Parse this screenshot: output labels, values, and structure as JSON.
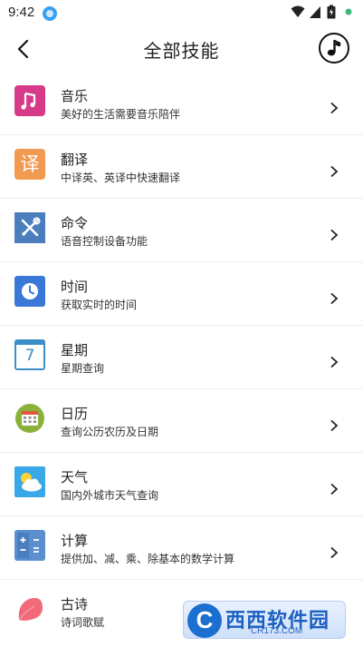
{
  "status_bar": {
    "time": "9:42"
  },
  "header": {
    "title": "全部技能"
  },
  "skills": [
    {
      "name": "音乐",
      "desc": "美好的生活需要音乐陪伴",
      "icon": "music-note-icon",
      "color": "#d83a8a"
    },
    {
      "name": "翻译",
      "desc": "中译英、英译中快速翻译",
      "icon": "translate-icon",
      "color": "#f39a52",
      "glyph": "译"
    },
    {
      "name": "命令",
      "desc": "语音控制设备功能",
      "icon": "tools-icon",
      "color": "#4a7ebd"
    },
    {
      "name": "时间",
      "desc": "获取实时的时间",
      "icon": "clock-icon",
      "color": "#3a78d8"
    },
    {
      "name": "星期",
      "desc": "星期查询",
      "icon": "calendar-icon",
      "color": "#3a8fc8",
      "glyph": "7"
    },
    {
      "name": "日历",
      "desc": "查询公历农历及日期",
      "icon": "calendar-grid-icon",
      "color": "#8cb13a"
    },
    {
      "name": "天气",
      "desc": "国内外城市天气查询",
      "icon": "weather-icon",
      "color": "#3aa8e8"
    },
    {
      "name": "计算",
      "desc": "提供加、减、乘、除基本的数学计算",
      "icon": "calculator-icon",
      "color": "#5b8fd0"
    },
    {
      "name": "古诗",
      "desc": "诗词歌赋",
      "icon": "petal-icon",
      "color": "#f26a7a"
    }
  ],
  "watermark": {
    "logo": "C",
    "text": "西西软件园",
    "sub": "CR173.COM"
  }
}
